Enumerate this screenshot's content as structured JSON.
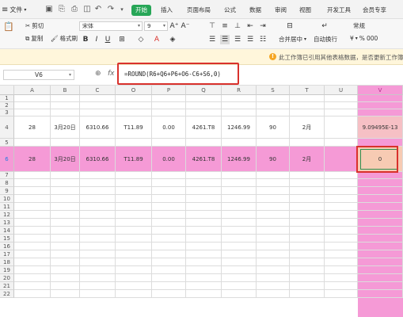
{
  "menu": {
    "file_label": "文件",
    "tabs": [
      "开始",
      "插入",
      "页面布局",
      "公式",
      "数据",
      "审阅",
      "视图",
      "开发工具",
      "会员专享"
    ],
    "active_tab": "开始"
  },
  "toolbar": {
    "cut_label": "剪切",
    "copy_label": "复制",
    "format_painter_label": "格式刷",
    "font_name": "宋体",
    "font_size": "9",
    "merge_label": "合并居中",
    "wrap_label": "自动换行",
    "number_format": "常规",
    "percent_symbol": "%",
    "thousand_sep": "000",
    "currency_symbol": "¥"
  },
  "notice": {
    "text": "此工作簿已引用其他表格数据，是否更新工作簿"
  },
  "formula_bar": {
    "cell_ref": "V6",
    "fx": "fx",
    "formula": "=ROUND(R6+Q6+P6+O6-C6+S6,0)"
  },
  "columns": [
    "A",
    "B",
    "C",
    "O",
    "P",
    "Q",
    "R",
    "S",
    "T",
    "U",
    "V"
  ],
  "rows": [
    "1",
    "2",
    "3",
    "4",
    "5",
    "6",
    "7",
    "8",
    "9",
    "10",
    "11",
    "12",
    "13",
    "14",
    "15",
    "16",
    "17",
    "18",
    "19",
    "20",
    "21",
    "22"
  ],
  "row4": [
    "28",
    "3月20日",
    "6310.66",
    "T11.89",
    "0.00",
    "4261.T8",
    "1246.99",
    "90",
    "2月",
    "",
    "9.09495E-13"
  ],
  "row6": [
    "28",
    "3月20日",
    "6310.66",
    "T11.89",
    "0.00",
    "4261.T8",
    "1246.99",
    "90",
    "2月",
    "",
    "0"
  ],
  "colors": {
    "highlight_pink": "#f59ad6",
    "selected_cell": "#f7cbb3",
    "accent_green": "#27a657",
    "callout_red": "#d9312c"
  }
}
